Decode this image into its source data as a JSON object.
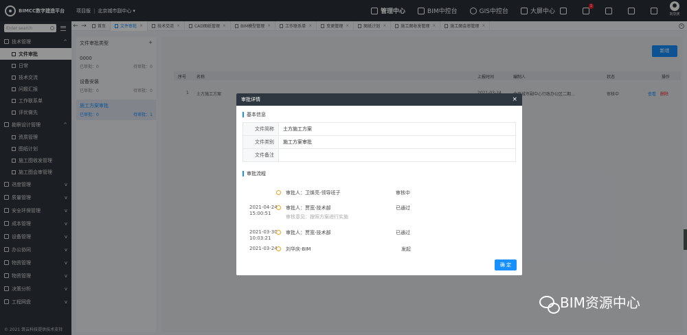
{
  "topbar": {
    "app_name": "BIMCC数字建造平台",
    "edition": "项目版",
    "org": "北京城市副中心",
    "org_arrow": "▾",
    "nav": [
      {
        "label": "管理中心",
        "active": true
      },
      {
        "label": "BIM中控台",
        "active": false
      },
      {
        "label": "GIS中控台",
        "active": false
      },
      {
        "label": "大屏中心",
        "active": false
      }
    ],
    "notification_count": "1",
    "user_name": "刘华庆"
  },
  "sidebar": {
    "search_placeholder": "Enter search",
    "groups": [
      {
        "label": "技术管理",
        "chevron": "^",
        "subs": [
          {
            "label": "文件审批",
            "active": true
          },
          {
            "label": "日常",
            "active": false
          },
          {
            "label": "技术交流",
            "active": false
          },
          {
            "label": "问题汇报",
            "active": false
          },
          {
            "label": "工作联系单",
            "active": false
          },
          {
            "label": "评优做先",
            "active": false
          }
        ]
      },
      {
        "label": "勘察设计管理",
        "chevron": "^",
        "subs": [
          {
            "label": "资质管理",
            "active": false
          },
          {
            "label": "图纸计划",
            "active": false
          },
          {
            "label": "施工图收发管理",
            "active": false
          },
          {
            "label": "施工图会审管理",
            "active": false
          }
        ]
      },
      {
        "label": "进度管理",
        "chevron": "v",
        "subs": []
      },
      {
        "label": "质量管理",
        "chevron": "v",
        "subs": []
      },
      {
        "label": "安全环保管理",
        "chevron": "v",
        "subs": []
      },
      {
        "label": "成本管理",
        "chevron": "v",
        "subs": []
      },
      {
        "label": "设备管理",
        "chevron": "v",
        "subs": []
      },
      {
        "label": "办公协同",
        "chevron": "v",
        "subs": []
      },
      {
        "label": "物资管理",
        "chevron": "v",
        "subs": []
      },
      {
        "label": "物资管理",
        "chevron": "v",
        "subs": []
      },
      {
        "label": "决策分析",
        "chevron": "v",
        "subs": []
      },
      {
        "label": "工程网盘",
        "chevron": "v",
        "subs": []
      }
    ],
    "copyright": "© 2021 筑云科技提供技术支持"
  },
  "tabs": [
    {
      "label": "首页",
      "closable": false,
      "active": false
    },
    {
      "label": "文件审批",
      "closable": true,
      "active": true
    },
    {
      "label": "技术交流",
      "closable": true,
      "active": false
    },
    {
      "label": "CAD图纸管理",
      "closable": true,
      "active": false
    },
    {
      "label": "BIM模型管理",
      "closable": true,
      "active": false
    },
    {
      "label": "工作联系单",
      "closable": true,
      "active": false
    },
    {
      "label": "变更管理",
      "closable": true,
      "active": false
    },
    {
      "label": "图纸计划",
      "closable": true,
      "active": false
    },
    {
      "label": "施工图收发管理",
      "closable": true,
      "active": false
    },
    {
      "label": "施工图会审管理",
      "closable": true,
      "active": false
    }
  ],
  "file_types": {
    "title": "文件审批类型",
    "add": "+",
    "items": [
      {
        "name": "0000",
        "passed": "已审批：0",
        "pending": "待审批：0",
        "active": false
      },
      {
        "name": "设备安装",
        "passed": "已审批：0",
        "pending": "待审批：0",
        "active": false
      },
      {
        "name": "施工方案审批",
        "passed": "已审批：0",
        "pending": "待审批：1",
        "active": true
      }
    ]
  },
  "table": {
    "new_button": "新增",
    "columns": [
      "序号",
      "名称",
      "上报时间",
      "编制人",
      "状态",
      "操作"
    ],
    "rows": [
      {
        "no": "1",
        "name": "土方施工方案",
        "time": "2021-03-24",
        "author": "北京城市副中心行政办公区二期...",
        "status": "审核中",
        "view": "查看",
        "delete": "删除"
      }
    ]
  },
  "modal": {
    "title": "审批详情",
    "close": "×",
    "basic_title": "基本信息",
    "fields": [
      {
        "key": "文件简称",
        "value": "土方施工方案"
      },
      {
        "key": "文件类别",
        "value": "施工方案审批"
      },
      {
        "key": "文件备注",
        "value": ""
      }
    ],
    "flow_title": "审批流程",
    "flow": [
      {
        "date": "",
        "time": "",
        "name": "审批人：卫焕亮-领导班子",
        "status": "审核中",
        "opinion": ""
      },
      {
        "date": "2021-04-24",
        "time": "15:00:51",
        "name": "审批人：贾宽-技术部",
        "status": "已通过",
        "opinion": "审核意见：按照方案进行实施"
      },
      {
        "date": "2021-03-30",
        "time": "10:03:21",
        "name": "审批人：贾宽-技术部",
        "status": "已通过",
        "opinion": ""
      },
      {
        "date": "2021-03-24",
        "time": "",
        "name": "刘华庆-BIM",
        "status": "发起",
        "opinion": ""
      }
    ],
    "ok": "确 定"
  },
  "watermark": "BIM资源中心"
}
